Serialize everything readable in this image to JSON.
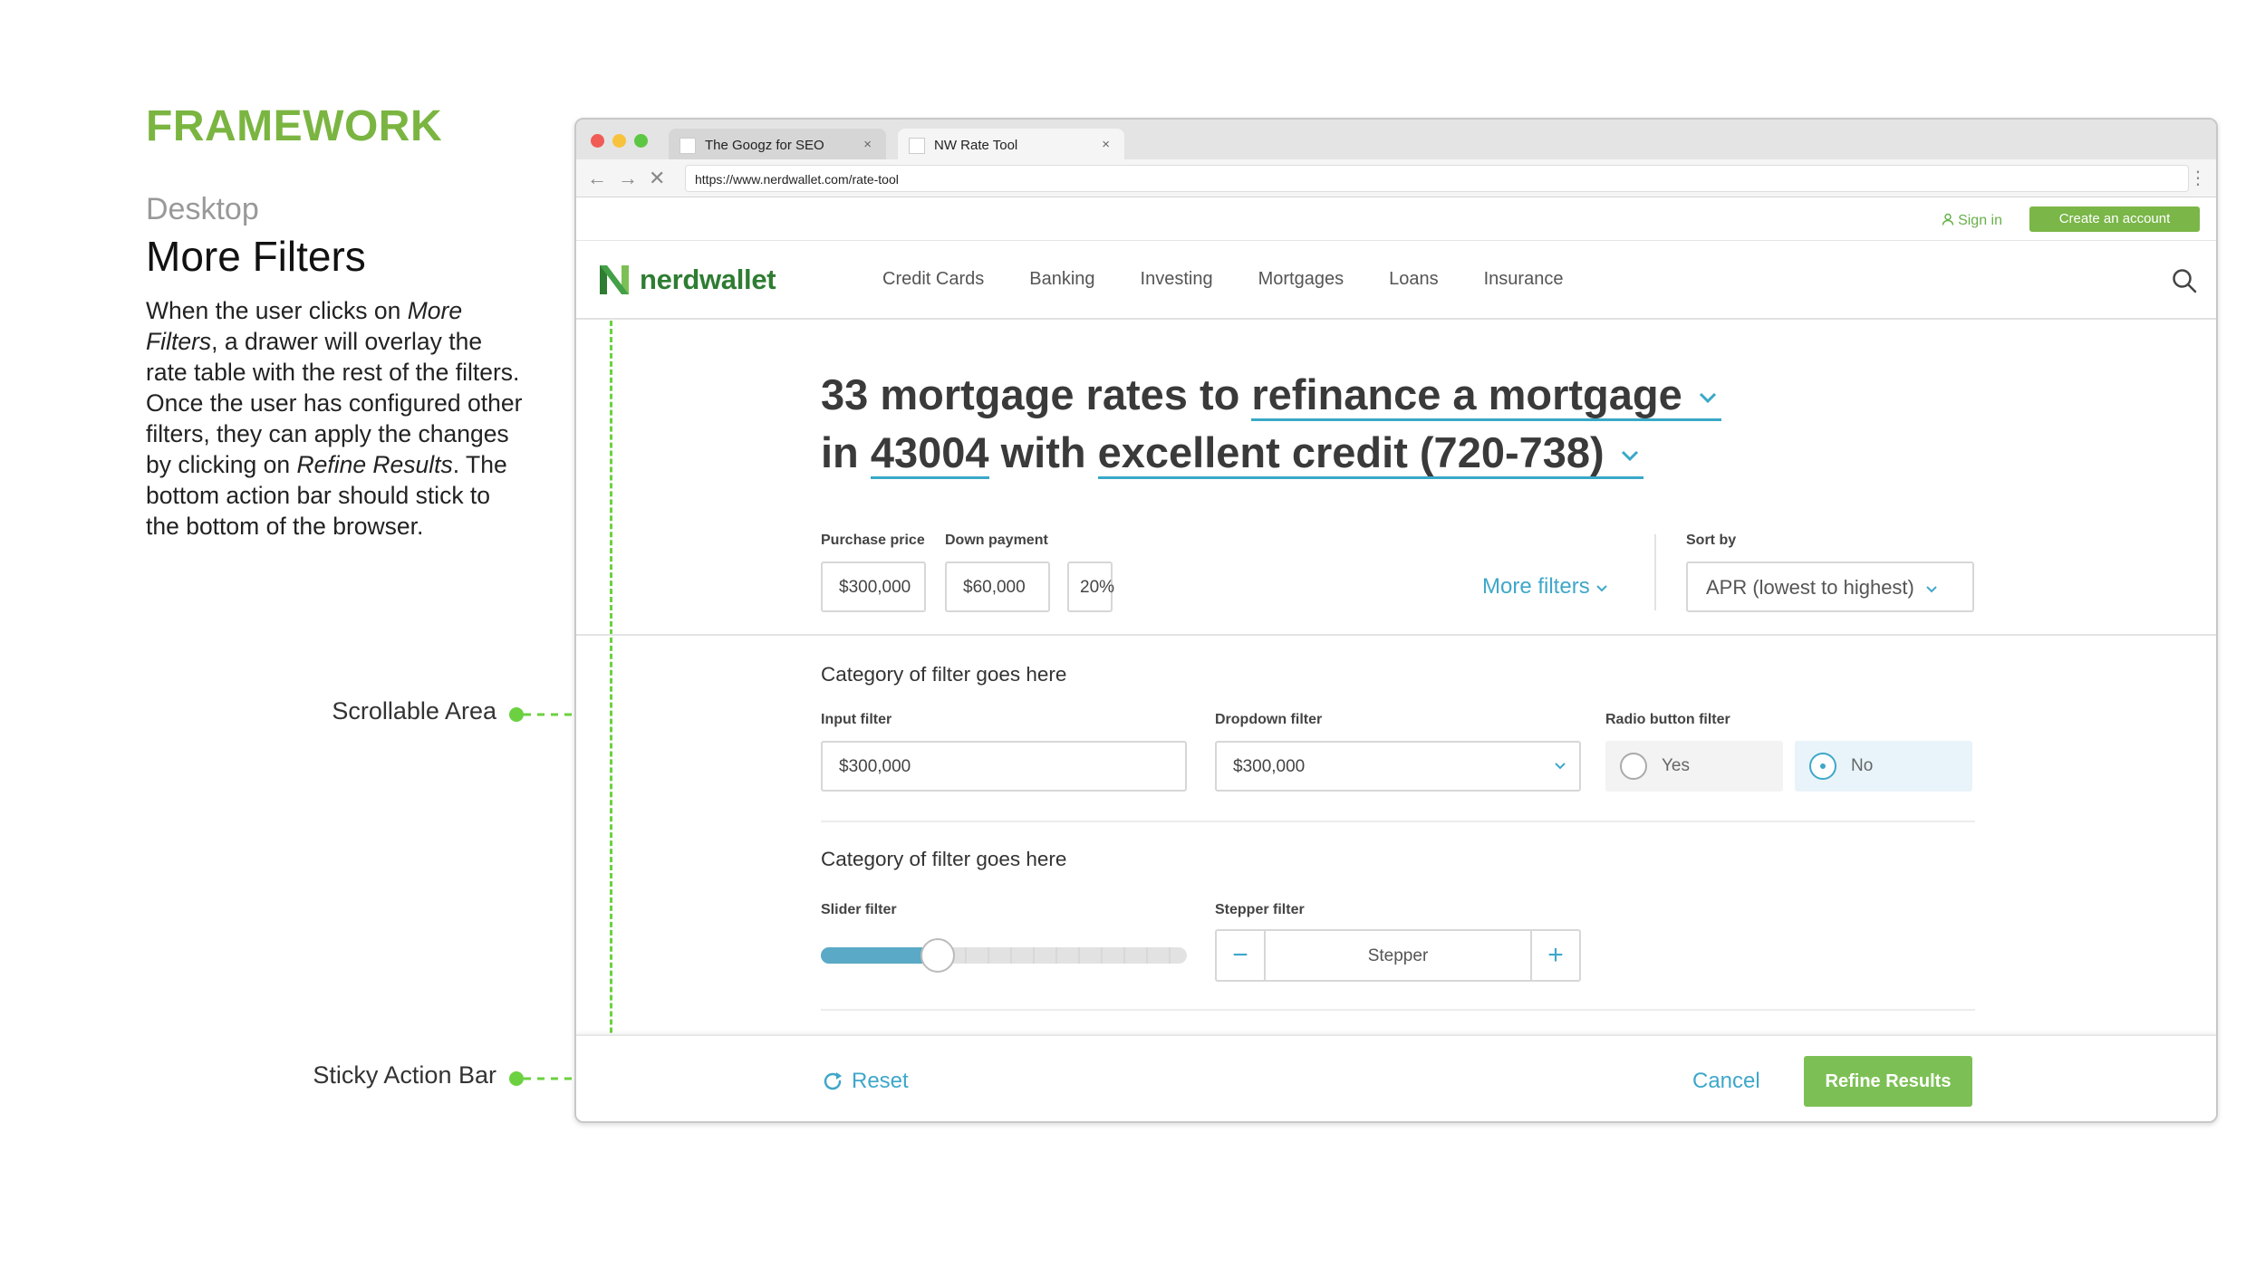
{
  "annotation": {
    "framework": "FRAMEWORK",
    "subhead": "Desktop",
    "title": "More Filters",
    "desc_1": "When the user clicks on ",
    "desc_2": "More Filters",
    "desc_3": ", a drawer will overlay the rate table with the rest of the filters. Once the user has configured other filters, they can apply the changes by clicking on ",
    "desc_4": "Refine Results",
    "desc_5": ". The bottom action bar should stick to the bottom of the browser.",
    "scrollable_label": "Scrollable Area",
    "sticky_label": "Sticky Action Bar",
    "accent": "#7bb541",
    "connector_color": "#6bd140"
  },
  "browser": {
    "tabs": [
      {
        "label": "The Googz for SEO",
        "close": "×"
      },
      {
        "label": "NW Rate Tool",
        "close": "×"
      }
    ],
    "url": "https://www.nerdwallet.com/rate-tool"
  },
  "header": {
    "sign_in": "Sign in",
    "create_account": "Create an account",
    "logo_text": "nerdwallet",
    "nav": [
      "Credit Cards",
      "Banking",
      "Investing",
      "Mortgages",
      "Loans",
      "Insurance"
    ]
  },
  "headline": {
    "part1": "33 mortgage rates to ",
    "purpose": "refinance a mortgage",
    "part2": "in ",
    "zip": "43004",
    "part3": " with ",
    "credit": "excellent credit (720-738)"
  },
  "top_filters": {
    "purchase_label": "Purchase price",
    "purchase_value": "$300,000",
    "down_label": "Down payment",
    "down_value": "$60,000",
    "down_percent": "20%",
    "more_filters": "More filters",
    "sort_label": "Sort by",
    "sort_value": "APR (lowest to highest)"
  },
  "drawer": {
    "category_1": "Category of filter goes here",
    "input_label": "Input filter",
    "input_value": "$300,000",
    "dropdown_label": "Dropdown filter",
    "dropdown_value": "$300,000",
    "radio_label": "Radio button filter",
    "radio_yes": "Yes",
    "radio_no": "No",
    "radio_selected": "No",
    "category_2": "Category of filter goes here",
    "slider_label": "Slider filter",
    "slider_level": 0.32,
    "stepper_label": "Stepper filter",
    "stepper_value": "Stepper",
    "stepper_minus": "−",
    "stepper_plus": "+"
  },
  "actions": {
    "reset": "Reset",
    "cancel": "Cancel",
    "refine": "Refine Results",
    "link_color": "#3fa7c9",
    "primary_color": "#7cc055"
  }
}
